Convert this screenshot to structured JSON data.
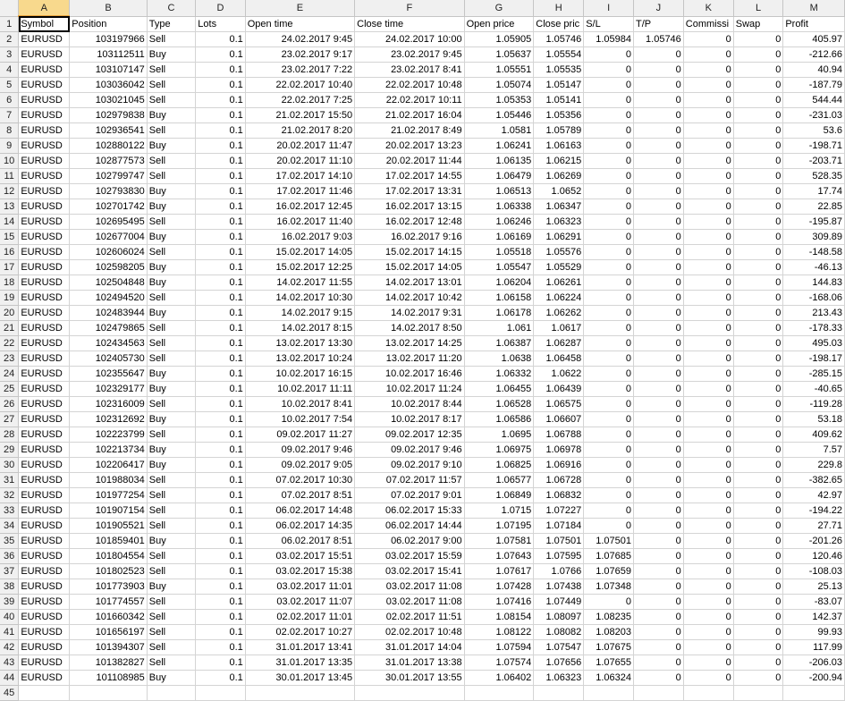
{
  "columns": [
    "A",
    "B",
    "C",
    "D",
    "E",
    "F",
    "G",
    "H",
    "I",
    "J",
    "K",
    "L",
    "M"
  ],
  "header_row": [
    "Symbol",
    "Position",
    "Type",
    "Lots",
    "Open time",
    "Close time",
    "Open price",
    "Close pric",
    "S/L",
    "T/P",
    "Commissi",
    "Swap",
    "Profit"
  ],
  "rows": [
    [
      "EURUSD",
      "103197966",
      "Sell",
      "0.1",
      "24.02.2017 9:45",
      "24.02.2017 10:00",
      "1.05905",
      "1.05746",
      "1.05984",
      "1.05746",
      "0",
      "0",
      "405.97"
    ],
    [
      "EURUSD",
      "103112511",
      "Buy",
      "0.1",
      "23.02.2017 9:17",
      "23.02.2017 9:45",
      "1.05637",
      "1.05554",
      "0",
      "0",
      "0",
      "0",
      "-212.66"
    ],
    [
      "EURUSD",
      "103107147",
      "Sell",
      "0.1",
      "23.02.2017 7:22",
      "23.02.2017 8:41",
      "1.05551",
      "1.05535",
      "0",
      "0",
      "0",
      "0",
      "40.94"
    ],
    [
      "EURUSD",
      "103036042",
      "Sell",
      "0.1",
      "22.02.2017 10:40",
      "22.02.2017 10:48",
      "1.05074",
      "1.05147",
      "0",
      "0",
      "0",
      "0",
      "-187.79"
    ],
    [
      "EURUSD",
      "103021045",
      "Sell",
      "0.1",
      "22.02.2017 7:25",
      "22.02.2017 10:11",
      "1.05353",
      "1.05141",
      "0",
      "0",
      "0",
      "0",
      "544.44"
    ],
    [
      "EURUSD",
      "102979838",
      "Buy",
      "0.1",
      "21.02.2017 15:50",
      "21.02.2017 16:04",
      "1.05446",
      "1.05356",
      "0",
      "0",
      "0",
      "0",
      "-231.03"
    ],
    [
      "EURUSD",
      "102936541",
      "Sell",
      "0.1",
      "21.02.2017 8:20",
      "21.02.2017 8:49",
      "1.0581",
      "1.05789",
      "0",
      "0",
      "0",
      "0",
      "53.6"
    ],
    [
      "EURUSD",
      "102880122",
      "Buy",
      "0.1",
      "20.02.2017 11:47",
      "20.02.2017 13:23",
      "1.06241",
      "1.06163",
      "0",
      "0",
      "0",
      "0",
      "-198.71"
    ],
    [
      "EURUSD",
      "102877573",
      "Sell",
      "0.1",
      "20.02.2017 11:10",
      "20.02.2017 11:44",
      "1.06135",
      "1.06215",
      "0",
      "0",
      "0",
      "0",
      "-203.71"
    ],
    [
      "EURUSD",
      "102799747",
      "Sell",
      "0.1",
      "17.02.2017 14:10",
      "17.02.2017 14:55",
      "1.06479",
      "1.06269",
      "0",
      "0",
      "0",
      "0",
      "528.35"
    ],
    [
      "EURUSD",
      "102793830",
      "Buy",
      "0.1",
      "17.02.2017 11:46",
      "17.02.2017 13:31",
      "1.06513",
      "1.0652",
      "0",
      "0",
      "0",
      "0",
      "17.74"
    ],
    [
      "EURUSD",
      "102701742",
      "Buy",
      "0.1",
      "16.02.2017 12:45",
      "16.02.2017 13:15",
      "1.06338",
      "1.06347",
      "0",
      "0",
      "0",
      "0",
      "22.85"
    ],
    [
      "EURUSD",
      "102695495",
      "Sell",
      "0.1",
      "16.02.2017 11:40",
      "16.02.2017 12:48",
      "1.06246",
      "1.06323",
      "0",
      "0",
      "0",
      "0",
      "-195.87"
    ],
    [
      "EURUSD",
      "102677004",
      "Buy",
      "0.1",
      "16.02.2017 9:03",
      "16.02.2017 9:16",
      "1.06169",
      "1.06291",
      "0",
      "0",
      "0",
      "0",
      "309.89"
    ],
    [
      "EURUSD",
      "102606024",
      "Sell",
      "0.1",
      "15.02.2017 14:05",
      "15.02.2017 14:15",
      "1.05518",
      "1.05576",
      "0",
      "0",
      "0",
      "0",
      "-148.58"
    ],
    [
      "EURUSD",
      "102598205",
      "Buy",
      "0.1",
      "15.02.2017 12:25",
      "15.02.2017 14:05",
      "1.05547",
      "1.05529",
      "0",
      "0",
      "0",
      "0",
      "-46.13"
    ],
    [
      "EURUSD",
      "102504848",
      "Buy",
      "0.1",
      "14.02.2017 11:55",
      "14.02.2017 13:01",
      "1.06204",
      "1.06261",
      "0",
      "0",
      "0",
      "0",
      "144.83"
    ],
    [
      "EURUSD",
      "102494520",
      "Sell",
      "0.1",
      "14.02.2017 10:30",
      "14.02.2017 10:42",
      "1.06158",
      "1.06224",
      "0",
      "0",
      "0",
      "0",
      "-168.06"
    ],
    [
      "EURUSD",
      "102483944",
      "Buy",
      "0.1",
      "14.02.2017 9:15",
      "14.02.2017 9:31",
      "1.06178",
      "1.06262",
      "0",
      "0",
      "0",
      "0",
      "213.43"
    ],
    [
      "EURUSD",
      "102479865",
      "Sell",
      "0.1",
      "14.02.2017 8:15",
      "14.02.2017 8:50",
      "1.061",
      "1.0617",
      "0",
      "0",
      "0",
      "0",
      "-178.33"
    ],
    [
      "EURUSD",
      "102434563",
      "Sell",
      "0.1",
      "13.02.2017 13:30",
      "13.02.2017 14:25",
      "1.06387",
      "1.06287",
      "0",
      "0",
      "0",
      "0",
      "495.03"
    ],
    [
      "EURUSD",
      "102405730",
      "Sell",
      "0.1",
      "13.02.2017 10:24",
      "13.02.2017 11:20",
      "1.0638",
      "1.06458",
      "0",
      "0",
      "0",
      "0",
      "-198.17"
    ],
    [
      "EURUSD",
      "102355647",
      "Buy",
      "0.1",
      "10.02.2017 16:15",
      "10.02.2017 16:46",
      "1.06332",
      "1.0622",
      "0",
      "0",
      "0",
      "0",
      "-285.15"
    ],
    [
      "EURUSD",
      "102329177",
      "Buy",
      "0.1",
      "10.02.2017 11:11",
      "10.02.2017 11:24",
      "1.06455",
      "1.06439",
      "0",
      "0",
      "0",
      "0",
      "-40.65"
    ],
    [
      "EURUSD",
      "102316009",
      "Sell",
      "0.1",
      "10.02.2017 8:41",
      "10.02.2017 8:44",
      "1.06528",
      "1.06575",
      "0",
      "0",
      "0",
      "0",
      "-119.28"
    ],
    [
      "EURUSD",
      "102312692",
      "Buy",
      "0.1",
      "10.02.2017 7:54",
      "10.02.2017 8:17",
      "1.06586",
      "1.06607",
      "0",
      "0",
      "0",
      "0",
      "53.18"
    ],
    [
      "EURUSD",
      "102223799",
      "Sell",
      "0.1",
      "09.02.2017 11:27",
      "09.02.2017 12:35",
      "1.0695",
      "1.06788",
      "0",
      "0",
      "0",
      "0",
      "409.62"
    ],
    [
      "EURUSD",
      "102213734",
      "Buy",
      "0.1",
      "09.02.2017 9:46",
      "09.02.2017 9:46",
      "1.06975",
      "1.06978",
      "0",
      "0",
      "0",
      "0",
      "7.57"
    ],
    [
      "EURUSD",
      "102206417",
      "Buy",
      "0.1",
      "09.02.2017 9:05",
      "09.02.2017 9:10",
      "1.06825",
      "1.06916",
      "0",
      "0",
      "0",
      "0",
      "229.8"
    ],
    [
      "EURUSD",
      "101988034",
      "Sell",
      "0.1",
      "07.02.2017 10:30",
      "07.02.2017 11:57",
      "1.06577",
      "1.06728",
      "0",
      "0",
      "0",
      "0",
      "-382.65"
    ],
    [
      "EURUSD",
      "101977254",
      "Sell",
      "0.1",
      "07.02.2017 8:51",
      "07.02.2017 9:01",
      "1.06849",
      "1.06832",
      "0",
      "0",
      "0",
      "0",
      "42.97"
    ],
    [
      "EURUSD",
      "101907154",
      "Sell",
      "0.1",
      "06.02.2017 14:48",
      "06.02.2017 15:33",
      "1.0715",
      "1.07227",
      "0",
      "0",
      "0",
      "0",
      "-194.22"
    ],
    [
      "EURUSD",
      "101905521",
      "Sell",
      "0.1",
      "06.02.2017 14:35",
      "06.02.2017 14:44",
      "1.07195",
      "1.07184",
      "0",
      "0",
      "0",
      "0",
      "27.71"
    ],
    [
      "EURUSD",
      "101859401",
      "Buy",
      "0.1",
      "06.02.2017 8:51",
      "06.02.2017 9:00",
      "1.07581",
      "1.07501",
      "1.07501",
      "0",
      "0",
      "0",
      "-201.26"
    ],
    [
      "EURUSD",
      "101804554",
      "Sell",
      "0.1",
      "03.02.2017 15:51",
      "03.02.2017 15:59",
      "1.07643",
      "1.07595",
      "1.07685",
      "0",
      "0",
      "0",
      "120.46"
    ],
    [
      "EURUSD",
      "101802523",
      "Sell",
      "0.1",
      "03.02.2017 15:38",
      "03.02.2017 15:41",
      "1.07617",
      "1.0766",
      "1.07659",
      "0",
      "0",
      "0",
      "-108.03"
    ],
    [
      "EURUSD",
      "101773903",
      "Buy",
      "0.1",
      "03.02.2017 11:01",
      "03.02.2017 11:08",
      "1.07428",
      "1.07438",
      "1.07348",
      "0",
      "0",
      "0",
      "25.13"
    ],
    [
      "EURUSD",
      "101774557",
      "Sell",
      "0.1",
      "03.02.2017 11:07",
      "03.02.2017 11:08",
      "1.07416",
      "1.07449",
      "0",
      "0",
      "0",
      "0",
      "-83.07"
    ],
    [
      "EURUSD",
      "101660342",
      "Sell",
      "0.1",
      "02.02.2017 11:01",
      "02.02.2017 11:51",
      "1.08154",
      "1.08097",
      "1.08235",
      "0",
      "0",
      "0",
      "142.37"
    ],
    [
      "EURUSD",
      "101656197",
      "Sell",
      "0.1",
      "02.02.2017 10:27",
      "02.02.2017 10:48",
      "1.08122",
      "1.08082",
      "1.08203",
      "0",
      "0",
      "0",
      "99.93"
    ],
    [
      "EURUSD",
      "101394307",
      "Sell",
      "0.1",
      "31.01.2017 13:41",
      "31.01.2017 14:04",
      "1.07594",
      "1.07547",
      "1.07675",
      "0",
      "0",
      "0",
      "117.99"
    ],
    [
      "EURUSD",
      "101382827",
      "Sell",
      "0.1",
      "31.01.2017 13:35",
      "31.01.2017 13:38",
      "1.07574",
      "1.07656",
      "1.07655",
      "0",
      "0",
      "0",
      "-206.03"
    ],
    [
      "EURUSD",
      "101108985",
      "Buy",
      "0.1",
      "30.01.2017 13:45",
      "30.01.2017 13:55",
      "1.06402",
      "1.06323",
      "1.06324",
      "0",
      "0",
      "0",
      "-200.94"
    ]
  ],
  "last_row_number": "45"
}
